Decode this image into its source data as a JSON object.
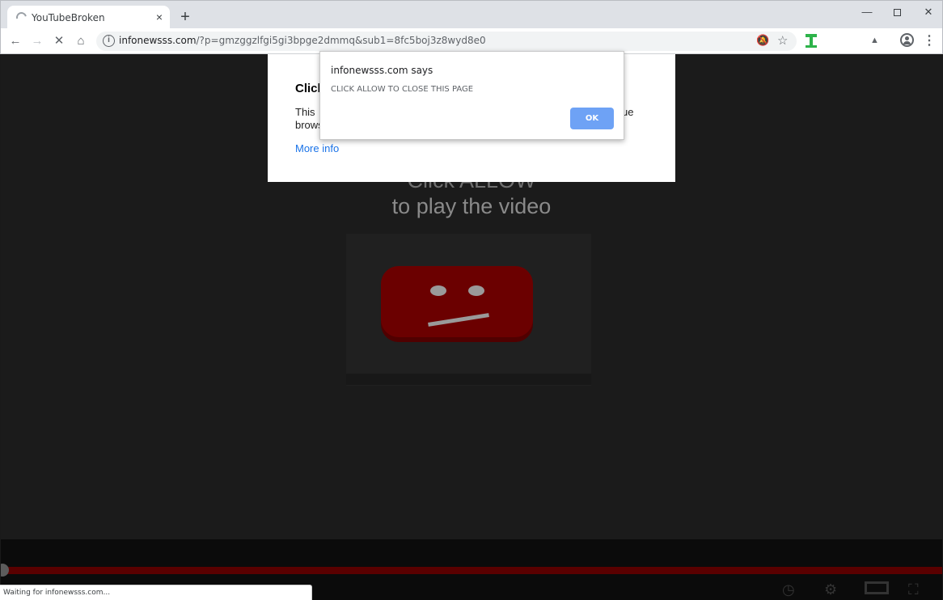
{
  "browser": {
    "tab": {
      "title": "YouTubeBroken",
      "close_glyph": "×",
      "loading": true
    },
    "new_tab_glyph": "+",
    "window_controls": {
      "minimize": "—",
      "close": "✕"
    },
    "nav": {
      "back": "←",
      "forward": "→",
      "stop": "✕",
      "home": "⌂"
    },
    "address": {
      "host": "infonewsss.com",
      "path": "/?p=gmzggzlfgi5gi3bpge2dmmq&sub1=8fc5boj3z8wyd8e0"
    },
    "icons": [
      "info-icon",
      "notifications-blocked-icon",
      "bookmark-star-icon",
      "extension-icon",
      "cast-icon",
      "profile-icon",
      "menu-icon"
    ],
    "menu_glyph": "⋮"
  },
  "page": {
    "headline_line1": "Click ALLOW",
    "headline_line2": "to play the video",
    "progress_fraction": 0.0,
    "accent_red": "#6b0000"
  },
  "allow_box": {
    "title": "Click",
    "body": "This                                                                                                                      ue browse",
    "more_info": "More info"
  },
  "alert": {
    "says": "infonewsss.com says",
    "message": "CLICK ALLOW TO CLOSE THIS PAGE",
    "ok": "OK",
    "ok_color": "#6ea2f5"
  },
  "status_bar": {
    "text": "Waiting for infonewsss.com..."
  }
}
